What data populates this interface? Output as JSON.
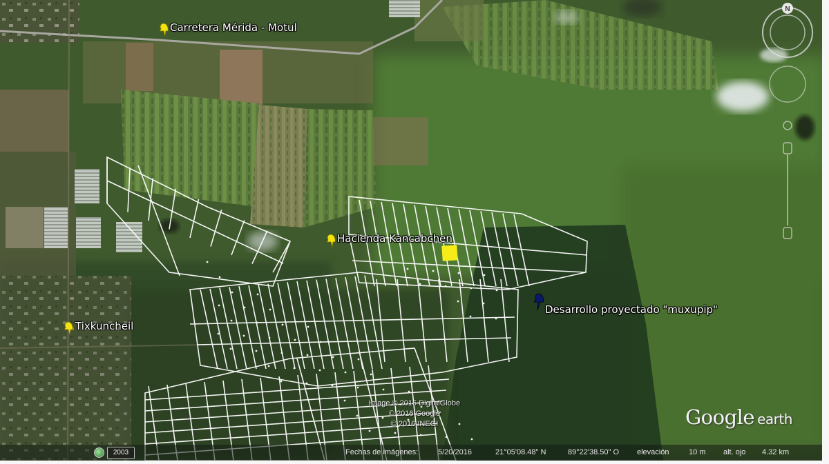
{
  "app": {
    "logo": "Google",
    "logo_suffix": "earth"
  },
  "placemarks": [
    {
      "id": "carretera",
      "label": "Carretera Mérida - Motul",
      "color": "#f2e20e"
    },
    {
      "id": "hacienda",
      "label": "Hacienda Kancabchen",
      "color": "#f2e20e"
    },
    {
      "id": "tixkuncheil",
      "label": "Tixkuncheil",
      "color": "#f2e20e"
    },
    {
      "id": "muxupip",
      "label": "Desarrollo proyectado \"muxupip\"",
      "color": "#0a1a6b"
    }
  ],
  "copyright": [
    "Image © 2016 DigitalGlobe",
    "© 2016 Google",
    "© 2016 INEGI"
  ],
  "statusbar": {
    "year": "2003",
    "imagery_date_label": "Fechas de imágenes:",
    "imagery_date": "5/20/2016",
    "latitude": "21°05'08.48\" N",
    "longitude": "89°22'38.50\" O",
    "elevation_label": "elevación",
    "elevation": "10 m",
    "eye_alt_label": "alt. ojo",
    "eye_alt": "4.32 km"
  },
  "nav_controls": {
    "north_label": "N"
  },
  "colors": {
    "parcel_lines": "#ffffff",
    "highlight_parcel": "#f5ec1a",
    "accent_pin": "#f2e20e"
  }
}
